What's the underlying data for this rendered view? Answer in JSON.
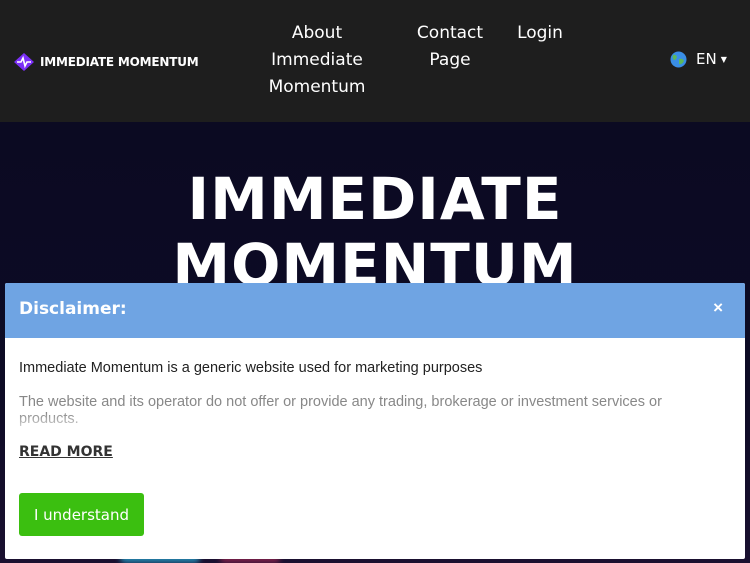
{
  "header": {
    "logo_text": "IMMEDIATE MOMENTUM",
    "nav": {
      "about_line1": "About",
      "about_line2": "Immediate",
      "about_line3": "Momentum",
      "contact_line1": "Contact",
      "contact_line2": "Page",
      "login": "Login"
    },
    "language": "EN"
  },
  "hero": {
    "title_line1": "IMMEDIATE",
    "title_line2": "MOMENTUM"
  },
  "disclaimer": {
    "title": "Disclaimer:",
    "close_label": "×",
    "line1": "Immediate Momentum is a generic website used for marketing purposes",
    "line2": "The website and its operator do not offer or provide any trading, brokerage or investment services or products.",
    "read_more": "READ MORE",
    "button": "I understand"
  },
  "colors": {
    "modal_header": "#6fa4e3",
    "button": "#3bbf10",
    "header_bg": "#1e1e1e"
  },
  "icons": [
    "logo-icon",
    "globe-icon",
    "caret-down-icon",
    "close-icon"
  ]
}
